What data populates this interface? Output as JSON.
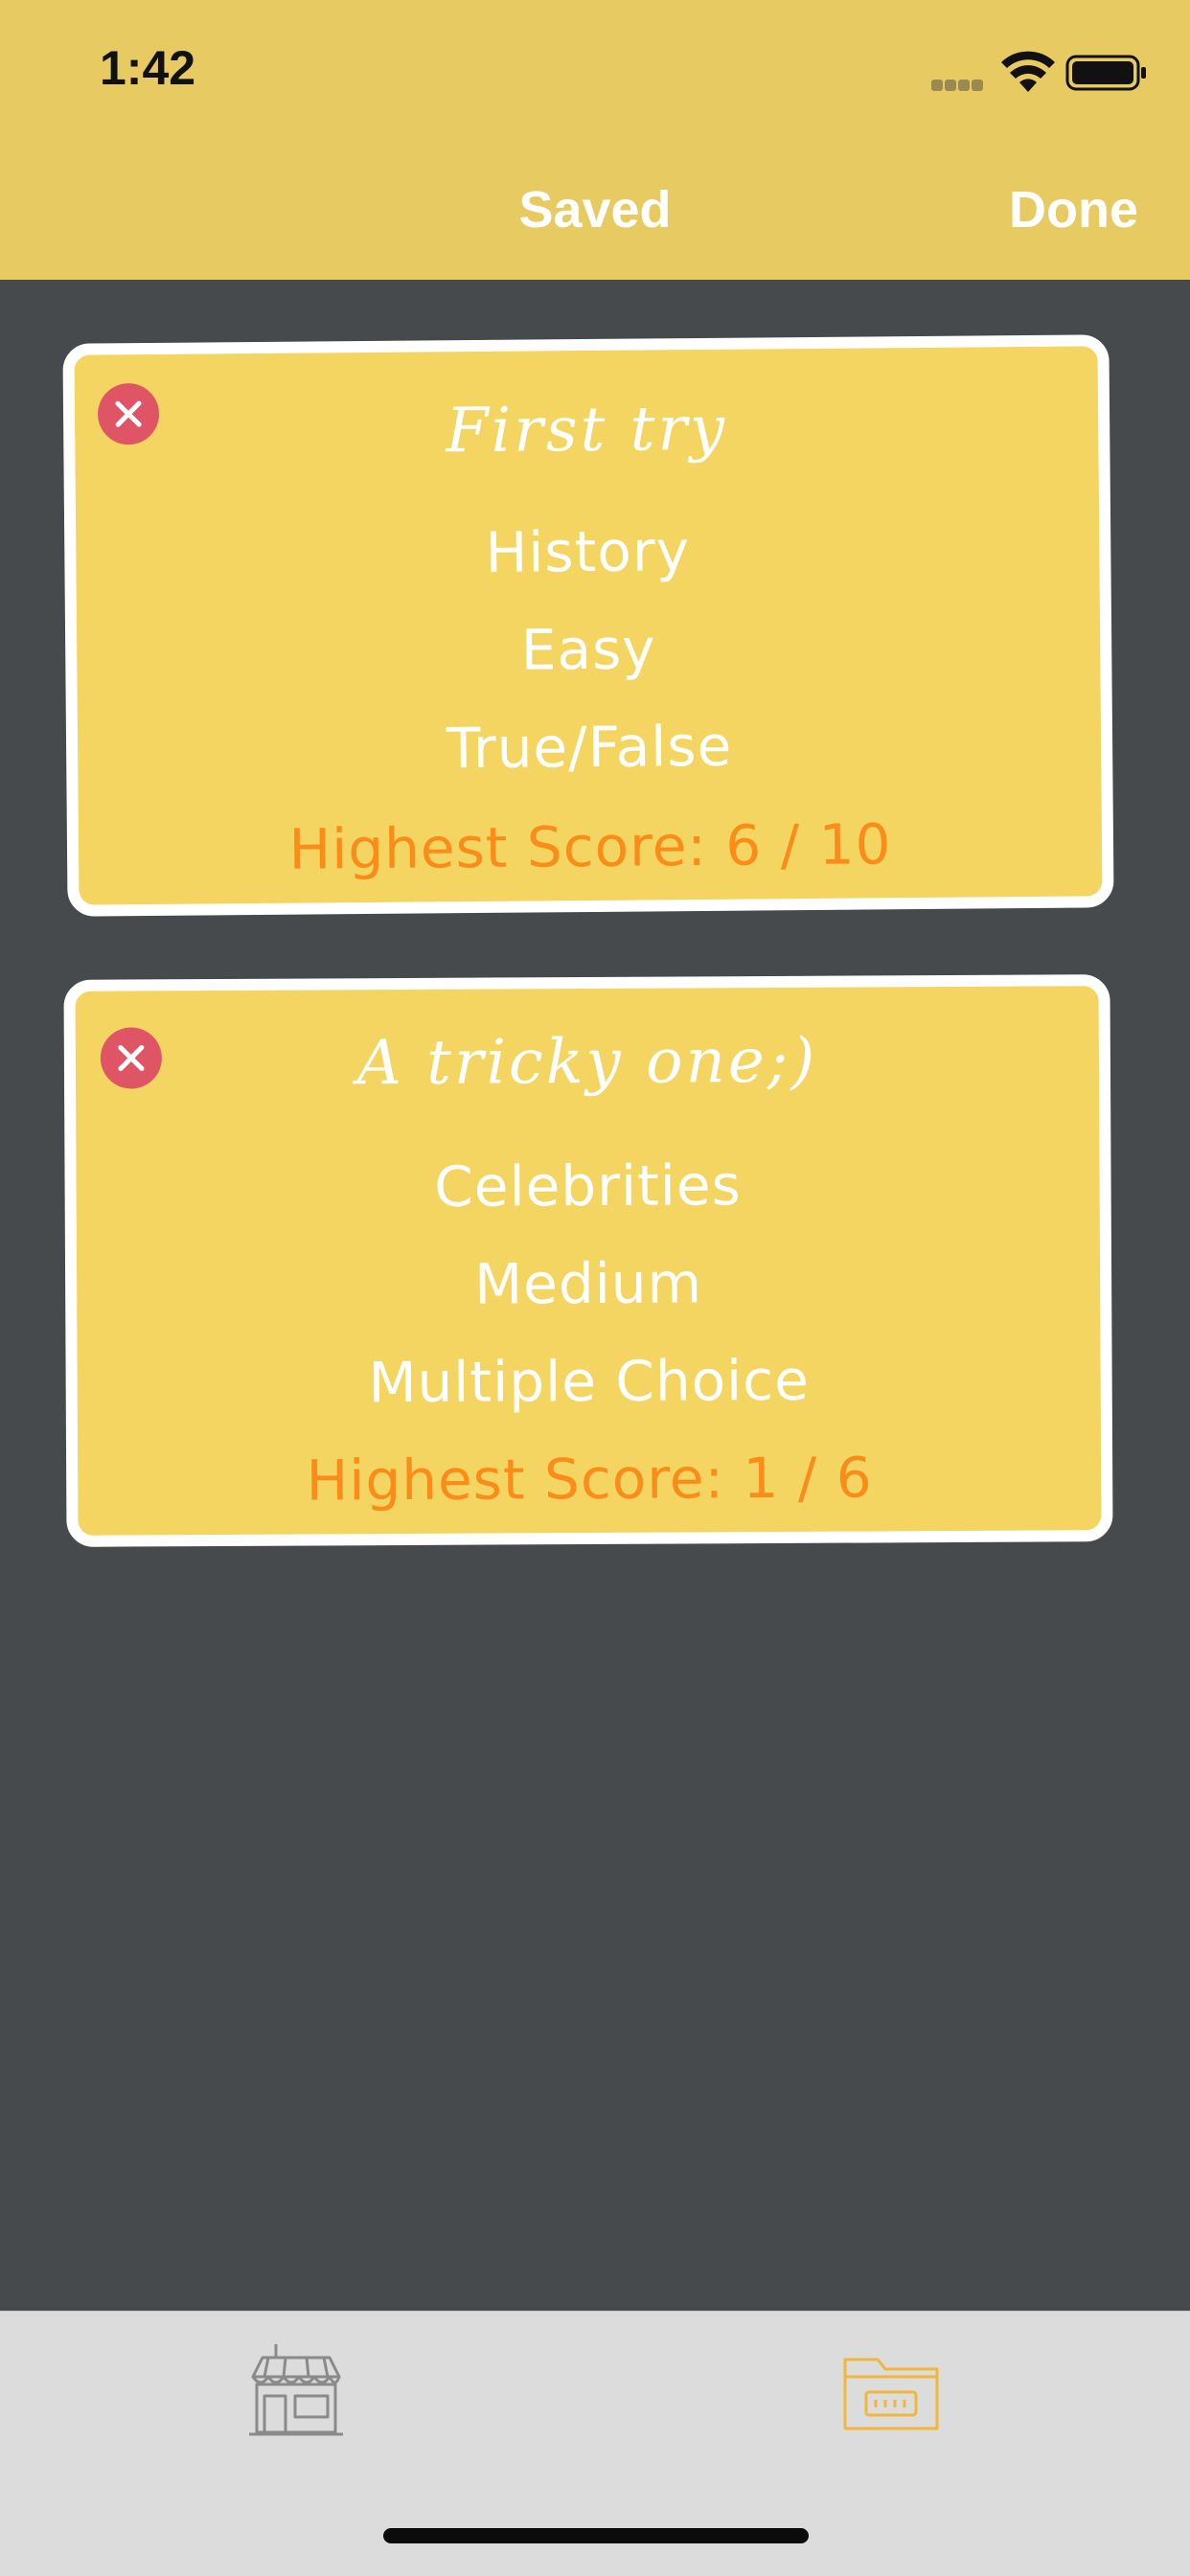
{
  "status_bar": {
    "time": "1:42"
  },
  "nav": {
    "title": "Saved",
    "done_label": "Done"
  },
  "cards": [
    {
      "title": "First try",
      "category": "History",
      "difficulty": "Easy",
      "type": "True/False",
      "score": "Highest Score: 6 / 10"
    },
    {
      "title": "A tricky one;)",
      "category": "Celebrities",
      "difficulty": "Medium",
      "type": "Multiple Choice",
      "score": "Highest Score: 1 / 6"
    }
  ],
  "tab_bar": {
    "items": [
      {
        "icon": "store-icon",
        "selected": false
      },
      {
        "icon": "folder-icon",
        "selected": true
      }
    ]
  },
  "colors": {
    "header": "#e8ca62",
    "background": "#464a4d",
    "card": "#f4d562",
    "card_border": "#ffffff",
    "score": "#fa8c1a",
    "delete": "#e05565",
    "tab_selected": "#f2b63a",
    "tab_unselected": "#8a8a8a"
  }
}
